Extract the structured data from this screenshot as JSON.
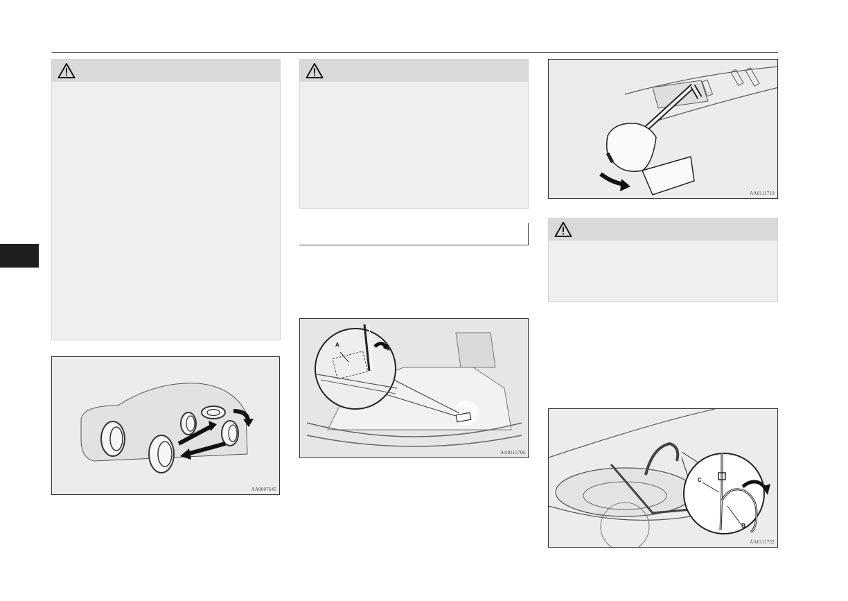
{
  "figures": {
    "tire_rotation": {
      "code": "AA0007645"
    },
    "luggage_floor": {
      "code": "AA0111706",
      "callout_a": "A"
    },
    "jack_handle": {
      "code": "AA0111719"
    },
    "spare_carrier": {
      "code": "AA0111722",
      "callout_b": "B",
      "callout_c": "C"
    }
  },
  "icons": {
    "warning": "warning-triangle-icon",
    "rotate": "rotate-arrow-icon"
  },
  "colors": {
    "warning_header": "#d9d9d9",
    "warning_body": "#efefef",
    "section_tab": "#1f1f1f"
  }
}
